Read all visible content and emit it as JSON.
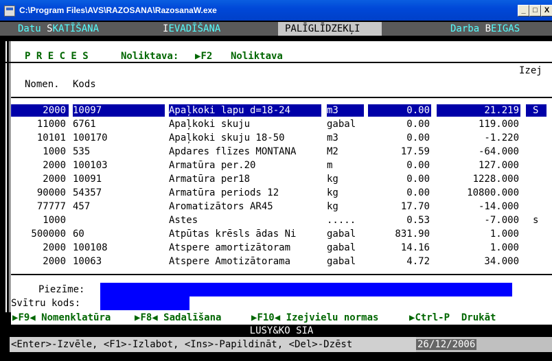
{
  "window": {
    "title": "C:\\Program Files\\AVS\\RAZOSANA\\RazosanaW.exe",
    "minimize": "_",
    "restore": "□",
    "close": "X"
  },
  "menu": [
    {
      "label_a": "Datu ",
      "hot": "S",
      "label_b": "KATĪŠANA"
    },
    {
      "label_a": "",
      "hot": "I",
      "label_b": "EVADĪŠANA"
    },
    {
      "label_a": "PALĪGLĪDZEKĻI",
      "hot": "",
      "label_b": ""
    },
    {
      "label_a": "Darba ",
      "hot": "B",
      "label_b": "EIGAS"
    }
  ],
  "header": {
    "section": "P R E C E S",
    "store_label": "Noliktava:",
    "key": "F2",
    "store_value": "Noliktava"
  },
  "columns": {
    "nomen": "Nomen.",
    "kods": "Kods",
    "izej": "Izej"
  },
  "rows": [
    {
      "nomen": "2000",
      "kods": "10097",
      "name": "Apaļkoki lapu d=18-24",
      "unit": "m3",
      "price": "0.00",
      "qty": "21.219",
      "flag": "S"
    },
    {
      "nomen": "11000",
      "kods": "6761",
      "name": "Apaļkoki skuju",
      "unit": "gabal",
      "price": "0.00",
      "qty": "119.000",
      "flag": ""
    },
    {
      "nomen": "10101",
      "kods": "100170",
      "name": "Apaļkoki skuju 18-50",
      "unit": "m3",
      "price": "0.00",
      "qty": "-1.220",
      "flag": ""
    },
    {
      "nomen": "1000",
      "kods": "535",
      "name": "Apdares flīzes MONTANA",
      "unit": "M2",
      "price": "17.59",
      "qty": "-64.000",
      "flag": ""
    },
    {
      "nomen": "2000",
      "kods": "100103",
      "name": "Armatūra per.20",
      "unit": "m",
      "price": "0.00",
      "qty": "127.000",
      "flag": ""
    },
    {
      "nomen": "2000",
      "kods": "10091",
      "name": "Armatūra per18",
      "unit": "kg",
      "price": "0.00",
      "qty": "1228.000",
      "flag": ""
    },
    {
      "nomen": "90000",
      "kods": "54357",
      "name": "Armatūra periods 12",
      "unit": "kg",
      "price": "0.00",
      "qty": "10800.000",
      "flag": ""
    },
    {
      "nomen": "77777",
      "kods": "457",
      "name": "Aromatizātors AR45",
      "unit": "kg",
      "price": "17.70",
      "qty": "-14.000",
      "flag": ""
    },
    {
      "nomen": "1000",
      "kods": "",
      "name": "Astes",
      "unit": ".....",
      "price": "0.53",
      "qty": "-7.000",
      "flag": "s"
    },
    {
      "nomen": "500000",
      "kods": "60",
      "name": "Atpūtas krēsls ādas Ni",
      "unit": "gabal",
      "price": "831.90",
      "qty": "1.000",
      "flag": ""
    },
    {
      "nomen": "2000",
      "kods": "100108",
      "name": "Atspere amortizātoram",
      "unit": "gabal",
      "price": "14.16",
      "qty": "1.000",
      "flag": ""
    },
    {
      "nomen": "2000",
      "kods": "10063",
      "name": "Atspere Amotizātorama",
      "unit": "gabal",
      "price": "4.72",
      "qty": "34.000",
      "flag": ""
    }
  ],
  "notes": {
    "piezime_label": "Piezīme:",
    "svitru_label": "Svītru kods:"
  },
  "fkeys": [
    {
      "key": "F9",
      "label": "Nomenklatūra"
    },
    {
      "key": "F8",
      "label": "Sadalīšana"
    },
    {
      "key": "F10",
      "label": "Izejvielu normas"
    },
    {
      "key": "Ctrl-P",
      "label": "Drukāt"
    }
  ],
  "company": "LUSY&KO SIA",
  "hint": "<Enter>-Izvēle, <F1>-Izlabot, <Ins>-Papildināt, <Del>-Dzēst",
  "date": "26/12/2006"
}
